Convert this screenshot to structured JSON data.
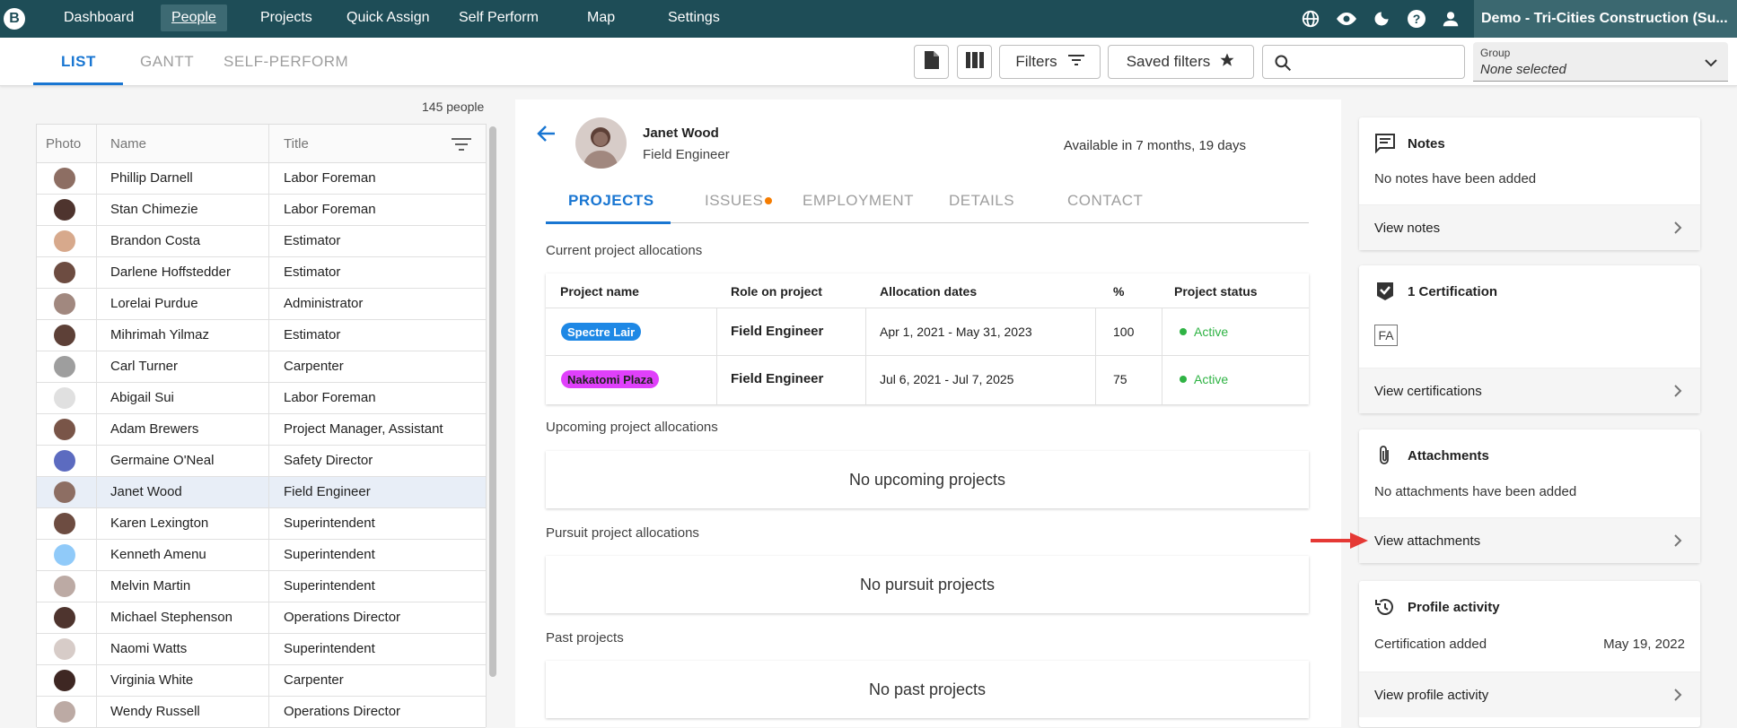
{
  "nav": {
    "logo": "B",
    "items": [
      "Dashboard",
      "People",
      "Projects",
      "Quick Assign",
      "Self Perform",
      "Map",
      "Settings"
    ],
    "active": "People",
    "org": "Demo - Tri-Cities Construction (Su..."
  },
  "subnav": {
    "tabs": [
      "LIST",
      "GANTT",
      "SELF-PERFORM"
    ],
    "active": "LIST",
    "filters_label": "Filters",
    "saved_filters_label": "Saved filters",
    "search_placeholder": "",
    "group_label": "Group",
    "group_value": "None selected"
  },
  "people_list": {
    "count": "145 people",
    "columns": [
      "Photo",
      "Name",
      "Title"
    ],
    "rows": [
      {
        "name": "Phillip Darnell",
        "title": "Labor Foreman",
        "color": "#8d6e63"
      },
      {
        "name": "Stan Chimezie",
        "title": "Labor Foreman",
        "color": "#4e342e"
      },
      {
        "name": "Brandon Costa",
        "title": "Estimator",
        "color": "#d7a98c"
      },
      {
        "name": "Darlene Hoffstedder",
        "title": "Estimator",
        "color": "#6d4c41"
      },
      {
        "name": "Lorelai Purdue",
        "title": "Administrator",
        "color": "#a1887f"
      },
      {
        "name": "Mihrimah Yilmaz",
        "title": "Estimator",
        "color": "#5d4037"
      },
      {
        "name": "Carl Turner",
        "title": "Carpenter",
        "color": "#9e9e9e"
      },
      {
        "name": "Abigail Sui",
        "title": "Labor Foreman",
        "color": "#e0e0e0"
      },
      {
        "name": "Adam Brewers",
        "title": "Project Manager, Assistant",
        "color": "#795548"
      },
      {
        "name": "Germaine O'Neal",
        "title": "Safety Director",
        "color": "#5c6bc0"
      },
      {
        "name": "Janet Wood",
        "title": "Field Engineer",
        "color": "#8d6e63"
      },
      {
        "name": "Karen Lexington",
        "title": "Superintendent",
        "color": "#6d4c41"
      },
      {
        "name": "Kenneth Amenu",
        "title": "Superintendent",
        "color": "#90caf9"
      },
      {
        "name": "Melvin Martin",
        "title": "Superintendent",
        "color": "#bcaaa4"
      },
      {
        "name": "Michael Stephenson",
        "title": "Operations Director",
        "color": "#4e342e"
      },
      {
        "name": "Naomi Watts",
        "title": "Superintendent",
        "color": "#d7ccc8"
      },
      {
        "name": "Virginia White",
        "title": "Carpenter",
        "color": "#3e2723"
      },
      {
        "name": "Wendy Russell",
        "title": "Operations Director",
        "color": "#bcaaa4"
      }
    ],
    "selected": "Janet Wood"
  },
  "profile": {
    "name": "Janet Wood",
    "title": "Field Engineer",
    "availability": "Available in 7 months, 19 days",
    "tabs": [
      "PROJECTS",
      "ISSUES",
      "EMPLOYMENT",
      "DETAILS",
      "CONTACT"
    ],
    "active_tab": "PROJECTS",
    "current_heading": "Current project allocations",
    "table_headers": [
      "Project name",
      "Role on project",
      "Allocation dates",
      "%",
      "Project status"
    ],
    "allocations": [
      {
        "project": "Spectre Lair",
        "chip_color": "#1e88e5",
        "chip_text_color": "#ffffff",
        "role": "Field Engineer",
        "dates": "Apr 1, 2021 - May 31, 2023",
        "percent": "100",
        "status": "Active"
      },
      {
        "project": "Nakatomi Plaza",
        "chip_color": "#e040fb",
        "chip_text_color": "#212121",
        "role": "Field Engineer",
        "dates": "Jul 6, 2021 - Jul 7, 2025",
        "percent": "75",
        "status": "Active"
      }
    ],
    "upcoming_heading": "Upcoming project allocations",
    "upcoming_empty": "No upcoming projects",
    "pursuit_heading": "Pursuit project allocations",
    "pursuit_empty": "No pursuit projects",
    "past_heading": "Past projects",
    "past_empty": "No past projects"
  },
  "side": {
    "notes": {
      "title": "Notes",
      "text": "No notes have been added",
      "link": "View notes"
    },
    "certs": {
      "title": "1 Certification",
      "badge": "FA",
      "link": "View certifications"
    },
    "attachments": {
      "title": "Attachments",
      "text": "No attachments have been added",
      "link": "View attachments"
    },
    "activity": {
      "title": "Profile activity",
      "item": "Certification added",
      "date": "May 19, 2022",
      "link": "View profile activity"
    }
  },
  "colors": {
    "accent": "#1976d2",
    "nav_bg": "#1e4d57",
    "active_status": "#2fb344",
    "issue_dot": "#f57c00",
    "arrow": "#e53935"
  }
}
